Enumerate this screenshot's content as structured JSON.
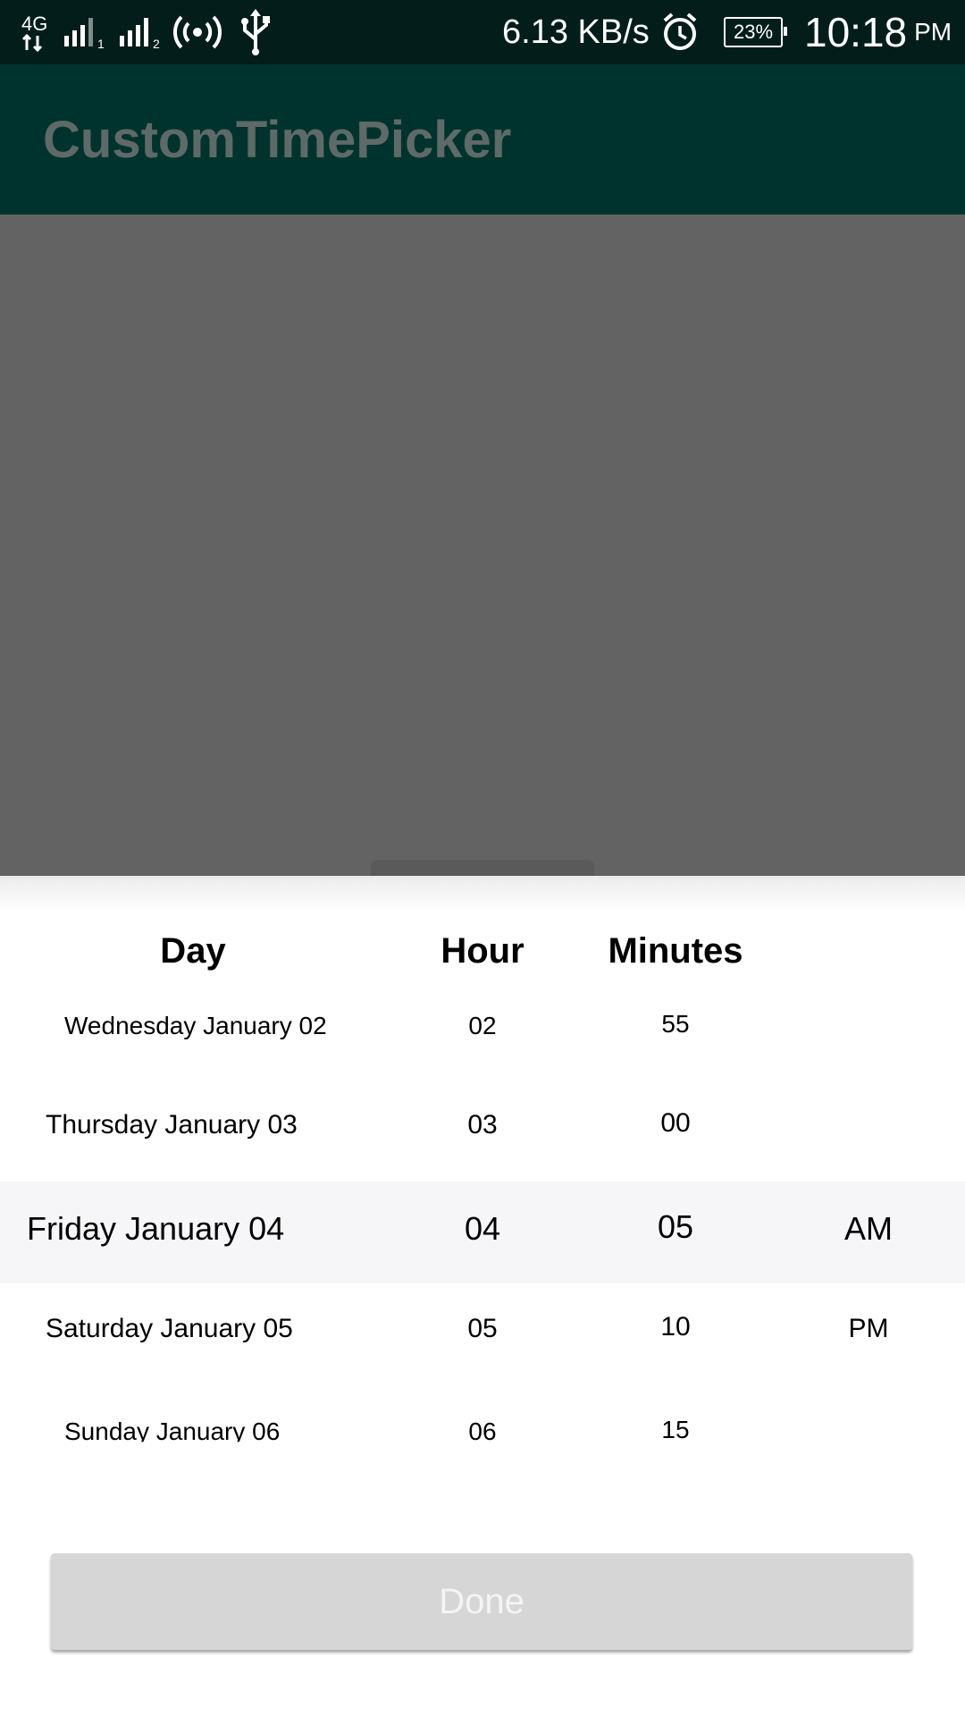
{
  "status_bar": {
    "network": "4G",
    "speed": "6.13 KB/s",
    "battery": "23%",
    "time": "10:18",
    "ampm": "PM",
    "icons": [
      "network-4g-icon",
      "signal-sim1-icon",
      "signal-sim2-icon",
      "hotspot-icon",
      "usb-icon",
      "alarm-icon",
      "battery-icon"
    ]
  },
  "app_bar": {
    "title": "CustomTimePicker"
  },
  "picker": {
    "headers": {
      "day": "Day",
      "hour": "Hour",
      "minutes": "Minutes"
    },
    "days": [
      "Wednesday January 02",
      "Thursday January 03",
      "Friday January 04",
      "Saturday January 05",
      "Sunday January 06"
    ],
    "hours": [
      "02",
      "03",
      "04",
      "05",
      "06"
    ],
    "minutes": [
      "55",
      "00",
      "05",
      "10",
      "15"
    ],
    "ampm": [
      "AM",
      "PM"
    ],
    "selected": {
      "day": "Friday January 04",
      "hour": "04",
      "minute": "05",
      "ampm": "AM"
    }
  },
  "done_button": {
    "label": "Done"
  },
  "colors": {
    "status_bar": "#021d1a",
    "app_bar": "#00332d",
    "scrim": "#636363",
    "selected_row": "#f6f6f8",
    "button": "#d6d6d6"
  }
}
